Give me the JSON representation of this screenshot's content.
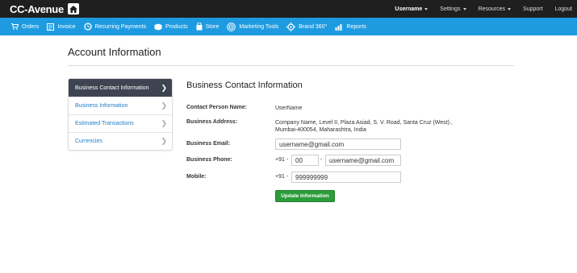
{
  "topbar": {
    "brand": "CC-Avenue",
    "username": "Username",
    "settings": "Settings",
    "resources": "Resources",
    "support": "Support",
    "logout": "Logout"
  },
  "nav": {
    "orders": "Orders",
    "invoice": "Invoice",
    "recurring": "Recurring Payments",
    "products": "Products",
    "store": "Store",
    "marketing": "Marketing Tools",
    "brand360": "Brand 360°",
    "reports": "Reports"
  },
  "page": {
    "title": "Account Information"
  },
  "sidebar": {
    "items": [
      {
        "label": "Business Contact Information"
      },
      {
        "label": "Business Information"
      },
      {
        "label": "Estimated Transactions"
      },
      {
        "label": "Currencies"
      }
    ]
  },
  "form": {
    "section_title": "Business Contact Information",
    "contact_person_label": "Contact Person Name:",
    "contact_person_value": "UserName",
    "address_label": "Business Address:",
    "address_line1": "Company Name, Level II, Plaza Asiad, S. V. Road, Santa Cruz (West).,",
    "address_line2": "Mumbai-400054, Maharashtra, India",
    "email_label": "Business Email:",
    "email_value": "username@gmail.com",
    "phone_label": "Business Phone:",
    "phone_prefix": "+91 -",
    "phone_area": "00",
    "phone_dash": "-",
    "phone_value": "username@gmail.com",
    "mobile_label": "Mobile:",
    "mobile_prefix": "+91 -",
    "mobile_value": "999999999",
    "update_button": "Update Information"
  }
}
